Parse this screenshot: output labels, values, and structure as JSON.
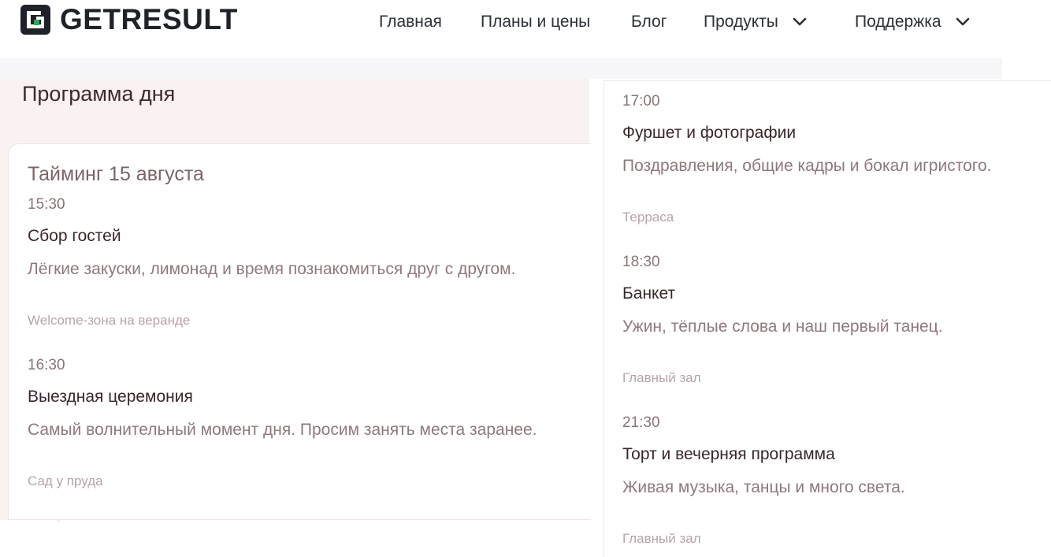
{
  "header": {
    "logo_text": "GETRESULT",
    "nav": [
      {
        "label": "Главная"
      },
      {
        "label": "Планы и цены"
      },
      {
        "label": "Блог"
      },
      {
        "label": "Продукты",
        "icon": "chevron-down-icon"
      },
      {
        "label": "Поддержка",
        "icon": "chevron-down-icon"
      }
    ]
  },
  "page": {
    "title": "Программа дня",
    "card_heading": "Тайминг 15 августа"
  },
  "events": [
    {
      "time": "15:30",
      "title": "Сбор гостей",
      "description": "Лёгкие закуски, лимонад и время познакомиться друг с другом.",
      "place": "Welcome-зона на веранде"
    },
    {
      "time": "16:30",
      "title": "Выездная церемония",
      "description": "Самый волнительный момент дня. Просим занять места заранее.",
      "place": "Сад у пруда"
    },
    {
      "time": "17:00",
      "title": "Фуршет и фотографии",
      "description": "Поздравления, общие кадры и бокал игристого.",
      "place": "Терраса"
    },
    {
      "time": "18:30",
      "title": "Банкет",
      "description": "Ужин, тёплые слова и наш первый танец.",
      "place": "Главный зал"
    },
    {
      "time": "21:30",
      "title": "Торт и вечерняя программа",
      "description": "Живая музыка, танцы и много света.",
      "place": "Главный зал"
    }
  ],
  "colors": {
    "logo_accent": "#22b14c",
    "logo_dark": "#1f2329",
    "page_bg": "#f9f2f1",
    "heading": "#7c6468",
    "text_dark": "#3a2629",
    "text_muted": "#8f787c",
    "place_text": "#b6a4a7"
  }
}
